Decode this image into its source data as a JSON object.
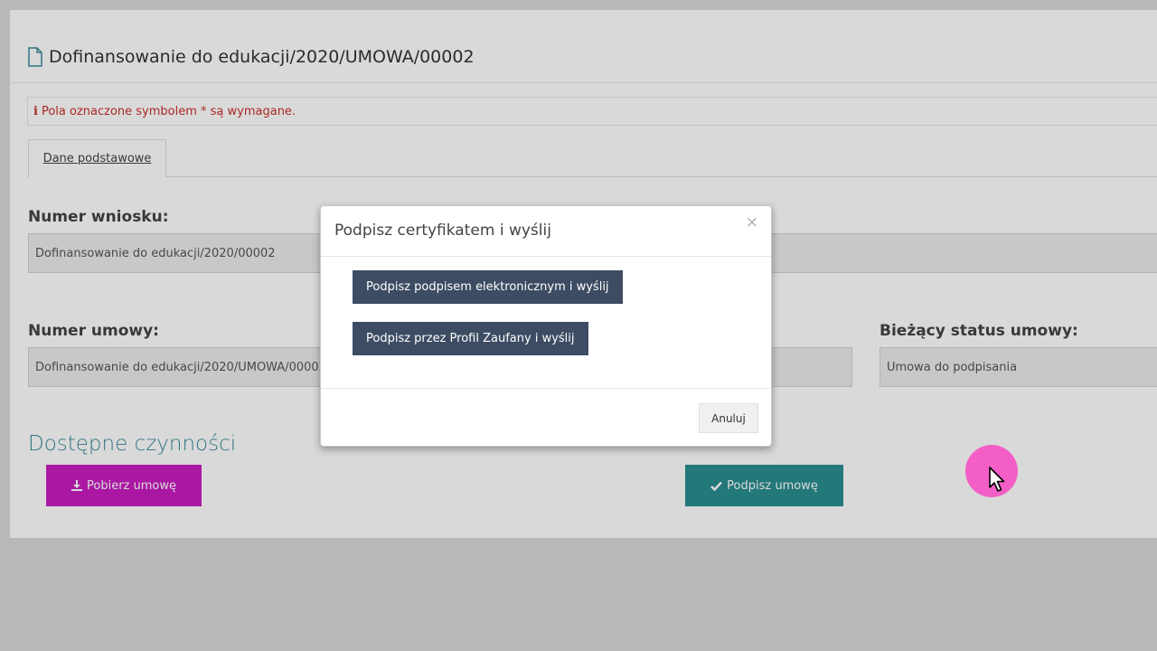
{
  "page": {
    "title": "Dofinansowanie do edukacji/2020/UMOWA/00002",
    "title_icon": "document-icon",
    "required_note": "Pola oznaczone symbolem * są wymagane.",
    "required_icon": "info-icon"
  },
  "tabs": [
    {
      "label": "Dane podstawowe"
    }
  ],
  "fields": {
    "application_number": {
      "label": "Numer wniosku:",
      "value": "Dofinansowanie do edukacji/2020/00002"
    },
    "contract_number": {
      "label": "Numer umowy:",
      "value": "Dofinansowanie do edukacji/2020/UMOWA/00002"
    },
    "contract_status": {
      "label": "Bieżący status umowy:",
      "value": "Umowa do podpisania"
    }
  },
  "actions": {
    "section_title": "Dostępne czynności",
    "download_label": "Pobierz umowę",
    "sign_label": "Podpisz umowę"
  },
  "modal": {
    "title": "Podpisz certyfikatem i wyślij",
    "close_glyph": "×",
    "sign_electronic_label": "Podpisz podpisem elektronicznym i wyślij",
    "sign_trusted_profile_label": "Podpisz przez Profil Zaufany i wyślij",
    "cancel_label": "Anuluj"
  },
  "colors": {
    "download_button": "#c81dc0",
    "sign_button": "#2a8d8f",
    "modal_button": "#3d4c63",
    "required_text": "#c9302c",
    "section_title": "#3a8a9a",
    "cursor_highlight": "#f35fc6"
  }
}
